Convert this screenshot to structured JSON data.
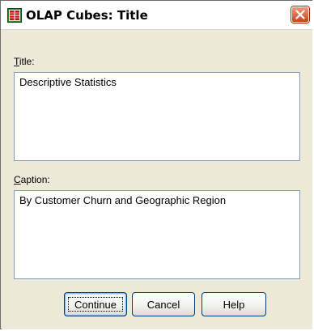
{
  "window": {
    "title": "OLAP Cubes: Title",
    "close_icon": "close-icon",
    "app_icon": "spss-dialog-icon"
  },
  "title_field": {
    "label_mnemonic": "T",
    "label_rest": "itle:",
    "value": "Descriptive Statistics"
  },
  "caption_field": {
    "label_mnemonic": "C",
    "label_rest": "aption:",
    "value": "By Customer Churn and Geographic Region"
  },
  "buttons": {
    "continue_label": "Continue",
    "cancel_label": "Cancel",
    "help_label": "Help"
  },
  "colors": {
    "dialog_background": "#ece9d8",
    "close_button": "#c8431b",
    "button_border": "#003c74"
  }
}
